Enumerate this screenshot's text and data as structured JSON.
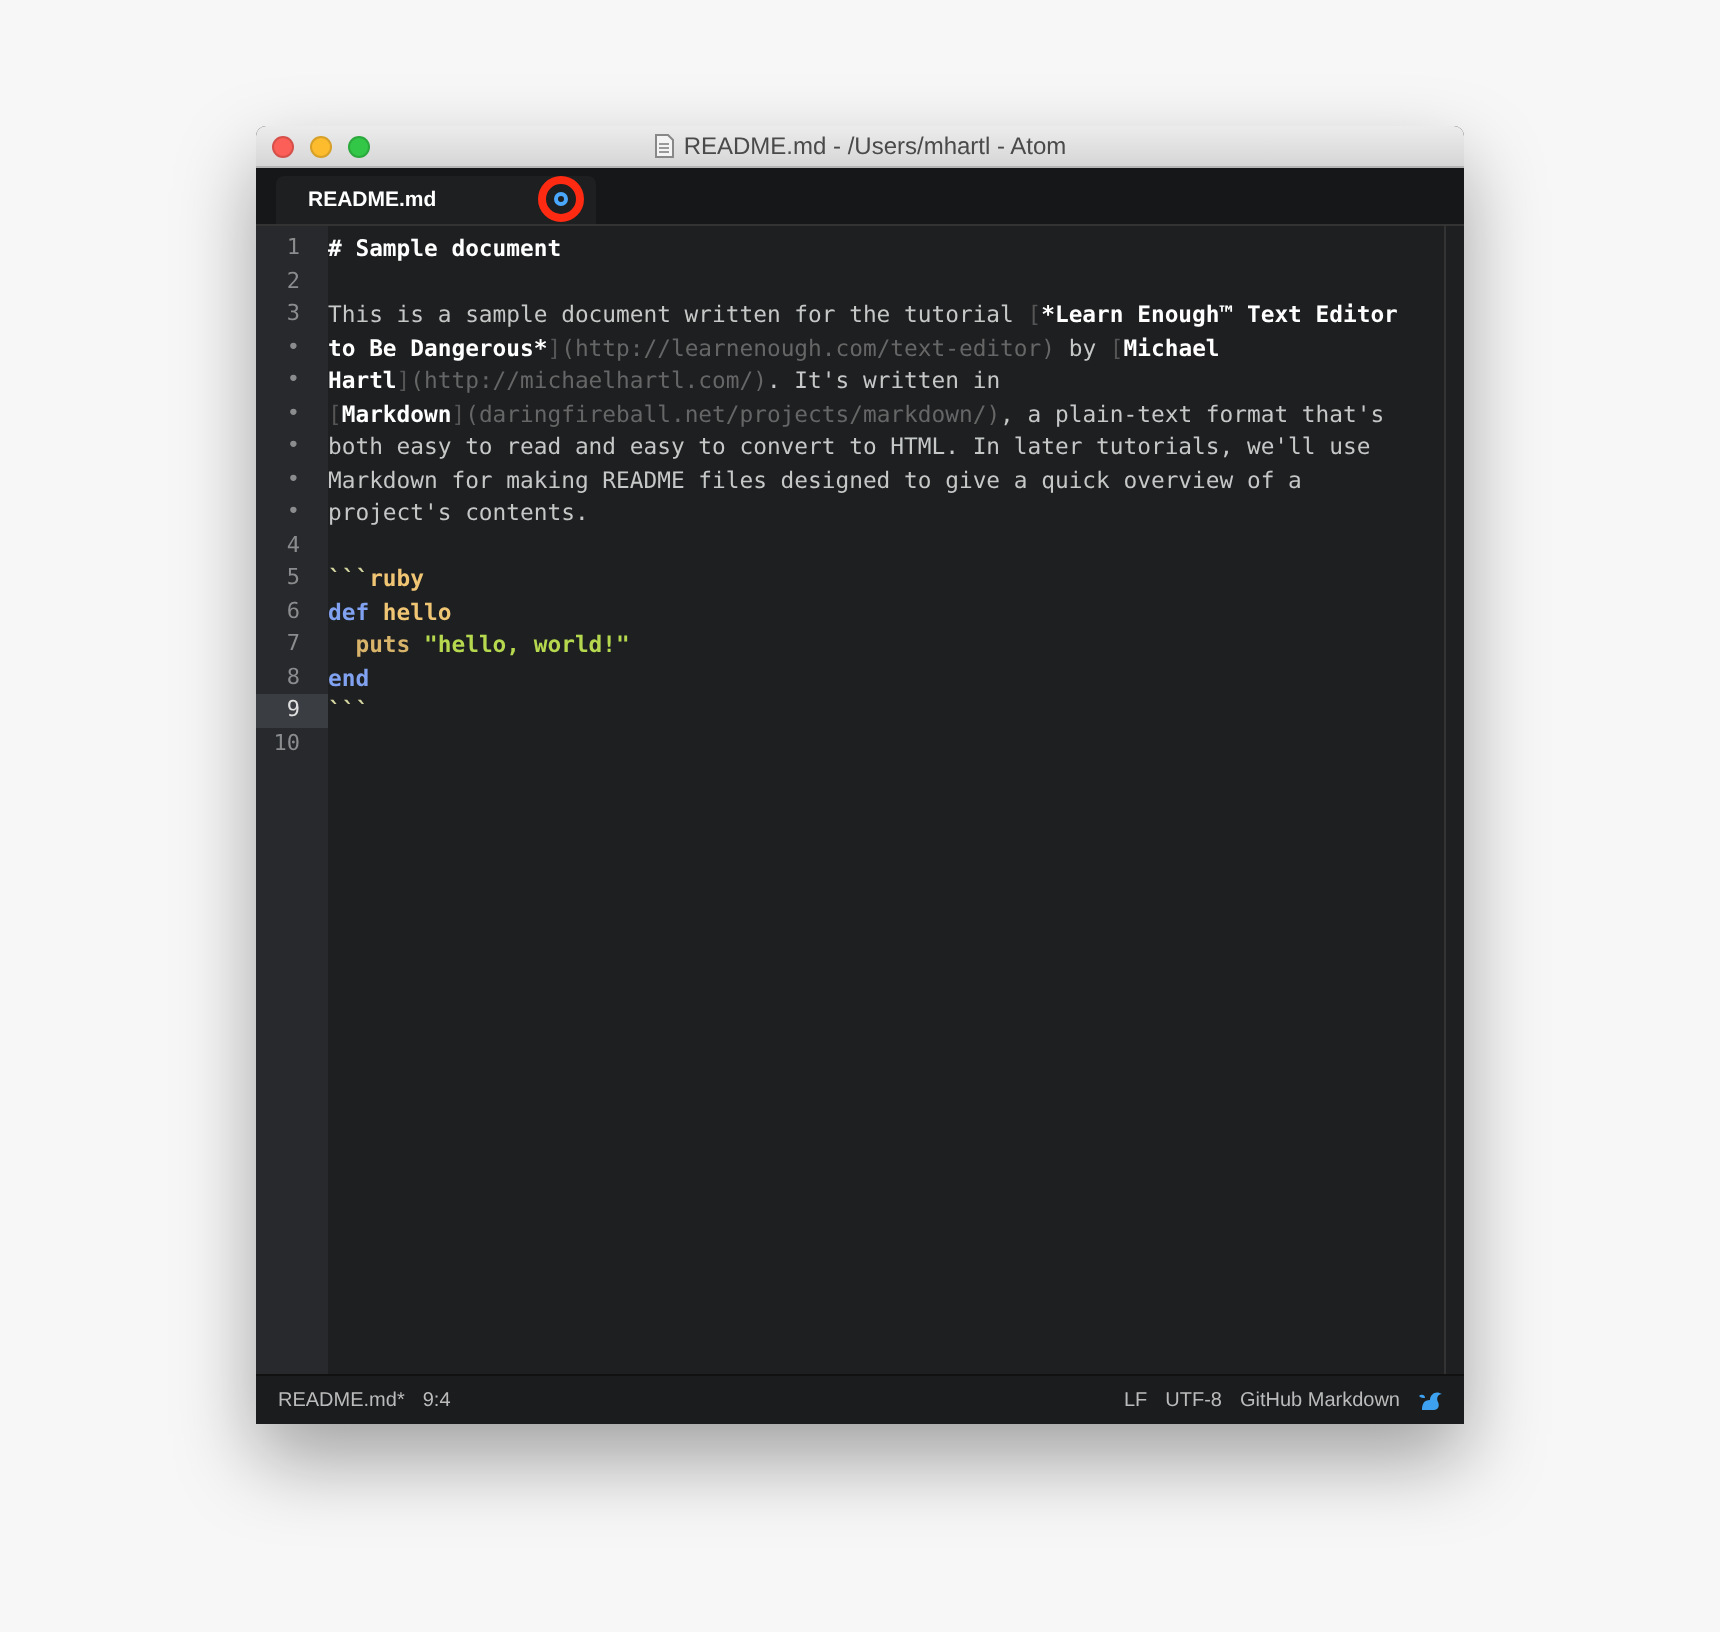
{
  "window": {
    "title": "README.md - /Users/mhartl - Atom"
  },
  "tabs": [
    {
      "label": "README.md",
      "selected": true,
      "modified": true
    }
  ],
  "editor": {
    "rows": [
      {
        "gutter": "1",
        "current": false,
        "tokens": [
          {
            "kind": "heading",
            "text": "# Sample document"
          }
        ]
      },
      {
        "gutter": "2",
        "current": false,
        "tokens": []
      },
      {
        "gutter": "3",
        "current": false,
        "tokens": [
          {
            "kind": "text",
            "text": "This is a sample document written for the tutorial "
          },
          {
            "kind": "bracket",
            "text": "["
          },
          {
            "kind": "bold",
            "text": "*Learn Enough™ Text Editor"
          }
        ]
      },
      {
        "gutter": "•",
        "current": false,
        "tokens": [
          {
            "kind": "bold",
            "text": "to Be Dangerous*"
          },
          {
            "kind": "bracket",
            "text": "]"
          },
          {
            "kind": "url",
            "text": "(http://learnenough.com/text-editor)"
          },
          {
            "kind": "text",
            "text": " by "
          },
          {
            "kind": "bracket",
            "text": "["
          },
          {
            "kind": "bold",
            "text": "Michael"
          }
        ]
      },
      {
        "gutter": "•",
        "current": false,
        "tokens": [
          {
            "kind": "bold",
            "text": "Hartl"
          },
          {
            "kind": "bracket",
            "text": "]"
          },
          {
            "kind": "url",
            "text": "(http://michaelhartl.com/)"
          },
          {
            "kind": "text",
            "text": ". It's written in"
          }
        ]
      },
      {
        "gutter": "•",
        "current": false,
        "tokens": [
          {
            "kind": "bracket",
            "text": "["
          },
          {
            "kind": "bold",
            "text": "Markdown"
          },
          {
            "kind": "bracket",
            "text": "]"
          },
          {
            "kind": "url",
            "text": "(daringfireball.net/projects/markdown/)"
          },
          {
            "kind": "text",
            "text": ", a plain-text format that's"
          }
        ]
      },
      {
        "gutter": "•",
        "current": false,
        "tokens": [
          {
            "kind": "text",
            "text": "both easy to read and easy to convert to HTML. In later tutorials, we'll use"
          }
        ]
      },
      {
        "gutter": "•",
        "current": false,
        "tokens": [
          {
            "kind": "text",
            "text": "Markdown for making README files designed to give a quick overview of a"
          }
        ]
      },
      {
        "gutter": "•",
        "current": false,
        "tokens": [
          {
            "kind": "text",
            "text": "project's contents."
          }
        ]
      },
      {
        "gutter": "4",
        "current": false,
        "tokens": []
      },
      {
        "gutter": "5",
        "current": false,
        "tokens": [
          {
            "kind": "fence",
            "text": "```"
          },
          {
            "kind": "lang",
            "text": "ruby"
          }
        ]
      },
      {
        "gutter": "6",
        "current": false,
        "tokens": [
          {
            "kind": "keyword",
            "text": "def"
          },
          {
            "kind": "name",
            "text": " hello"
          }
        ]
      },
      {
        "gutter": "7",
        "current": false,
        "tokens": [
          {
            "kind": "func",
            "text": "  puts"
          },
          {
            "kind": "string",
            "text": " \"hello, world!\""
          }
        ]
      },
      {
        "gutter": "8",
        "current": false,
        "tokens": [
          {
            "kind": "keyword",
            "text": "end"
          }
        ]
      },
      {
        "gutter": "9",
        "current": true,
        "tokens": [
          {
            "kind": "fence",
            "text": "```"
          }
        ]
      },
      {
        "gutter": "10",
        "current": false,
        "tokens": []
      }
    ]
  },
  "status_bar": {
    "left": [
      "README.md*",
      "9:4"
    ],
    "right": [
      "LF",
      "UTF-8",
      "GitHub Markdown"
    ]
  }
}
